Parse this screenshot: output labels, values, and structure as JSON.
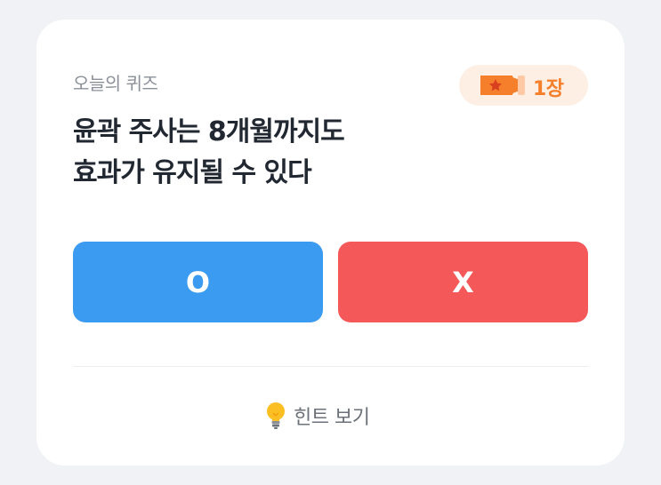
{
  "quiz": {
    "section_label": "오늘의 퀴즈",
    "ticket": {
      "icon": "star-ticket-icon",
      "count_label": "1장",
      "accent_color": "#f57f2a"
    },
    "question_lines": [
      "윤곽 주사는 8개월까지도",
      "효과가 유지될 수 있다"
    ],
    "answers": {
      "o_label": "O",
      "x_label": "X",
      "o_color": "#3a9bf0",
      "x_color": "#f55858"
    },
    "hint": {
      "icon": "lightbulb-icon",
      "label": "힌트 보기"
    }
  }
}
